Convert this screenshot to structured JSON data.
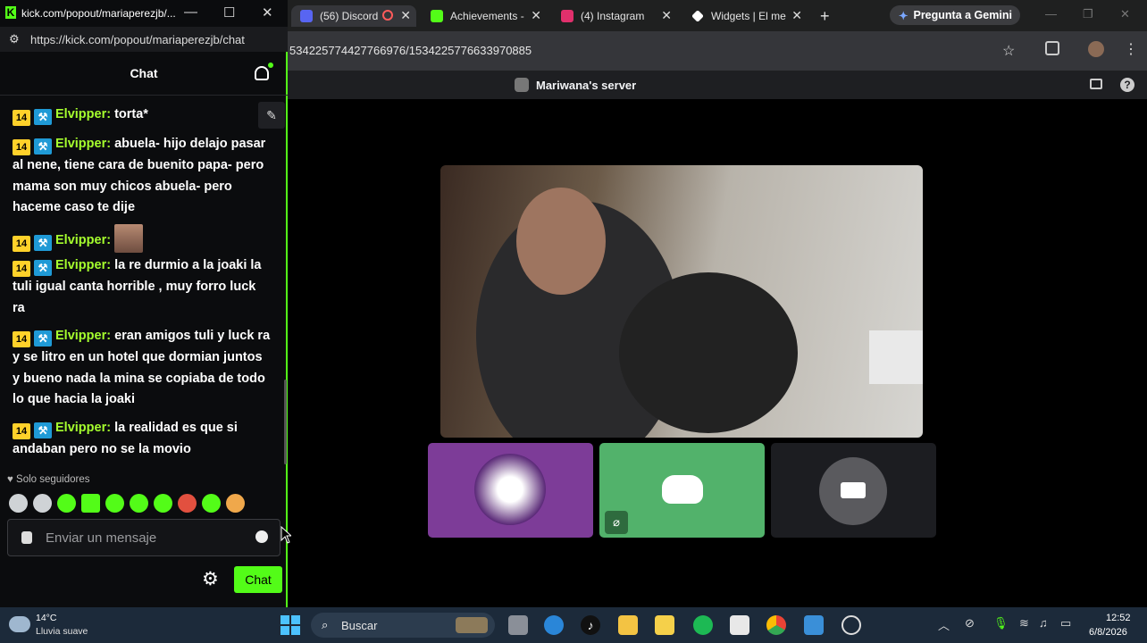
{
  "kick": {
    "window_title": "kick.com/popout/mariaperezjb/...",
    "url": "https://kick.com/popout/mariaperezjb/chat",
    "header_title": "Chat",
    "messages": [
      {
        "badge": "14",
        "user": "Elvipper",
        "text": "torta*"
      },
      {
        "badge": "14",
        "user": "Elvipper",
        "text": "abuela- hijo delajo pasar al nene, tiene cara de buenito papa- pero mama son muy chicos abuela- pero haceme caso te dije"
      },
      {
        "badge": "14",
        "user": "Elvipper",
        "text": ""
      },
      {
        "badge": "14",
        "user": "Elvipper",
        "text": "la re durmio a la joaki la tuli igual canta horrible , muy forro luck ra"
      },
      {
        "badge": "14",
        "user": "Elvipper",
        "text": "eran amigos tuli y luck ra y se litro en un hotel que dormian juntos y bueno nada la mina se copiaba de todo lo que hacia la joaki"
      },
      {
        "badge": "14",
        "user": "Elvipper",
        "text": "la realidad es que si andaban pero no se la movio"
      }
    ],
    "followers_only": "Solo seguidores",
    "input_placeholder": "Enviar un mensaje",
    "send_label": "Chat"
  },
  "browser": {
    "tabs": [
      {
        "label": "(56) Discord",
        "badge": "56",
        "color": "#5865f2"
      },
      {
        "label": "Achievements -",
        "color": "#53fc18"
      },
      {
        "label": "(4) Instagram",
        "color": "#e1306c"
      },
      {
        "label": "Widgets | El me",
        "color": "#ffffff"
      }
    ],
    "new_tab": "+",
    "gemini_label": "Pregunta a Gemini",
    "url_fragment": "534225774427766976/1534225776633970885",
    "server_name": "Mariwana's server"
  },
  "taskbar": {
    "temperature": "14°C",
    "weather": "Lluvia suave",
    "search_placeholder": "Buscar",
    "time": "12:52",
    "date": "6/8/2026"
  }
}
